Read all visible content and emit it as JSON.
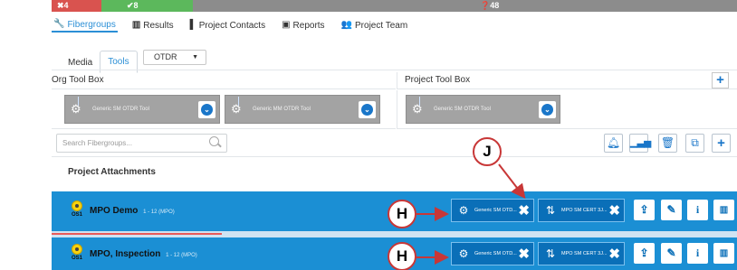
{
  "status": {
    "fail": "✖4",
    "pass": "✔8",
    "pending": "❓48"
  },
  "nav": {
    "fibergroups": "Fibergroups",
    "results": "Results",
    "project_contacts": "Project Contacts",
    "reports": "Reports",
    "project_team": "Project Team"
  },
  "subtabs": {
    "media": "Media",
    "tools": "Tools"
  },
  "otdr_select": {
    "value": "OTDR"
  },
  "org_toolbox": {
    "title": "Org Tool Box",
    "tools": [
      "Generic SM OTDR Tool",
      "Generic MM OTDR Tool"
    ]
  },
  "project_toolbox": {
    "title": "Project Tool Box",
    "tools": [
      "Generic SM OTDR Tool"
    ]
  },
  "search": {
    "placeholder": "Search Fibergroups..."
  },
  "attachments_title": "Project Attachments",
  "rows": [
    {
      "os": "OS1",
      "name": "MPO Demo",
      "count": "1 - 12",
      "sub": "(MPO)",
      "chips": [
        "Generic SM OTD...",
        "MPO SM CERT 3J..."
      ]
    },
    {
      "os": "OS1",
      "name": "MPO, Inspection",
      "count": "1 - 12",
      "sub": "(MPO)",
      "chips": [
        "Generic SM OTD...",
        "MPO SM CERT 3J..."
      ]
    }
  ],
  "callouts": {
    "j": "J",
    "h1": "H",
    "h2": "H"
  },
  "colors": {
    "row_bg": "#1b8fd4",
    "accent": "#1976c9",
    "callout_red": "#c83737",
    "fail": "#d9534f",
    "pass": "#5cb85c",
    "pending": "#8c8c8c"
  },
  "icons": {
    "fibergroups": "wrench-icon",
    "results": "bar-chart-icon",
    "project_contacts": "address-book-icon",
    "reports": "report-icon",
    "project_team": "team-icon"
  }
}
